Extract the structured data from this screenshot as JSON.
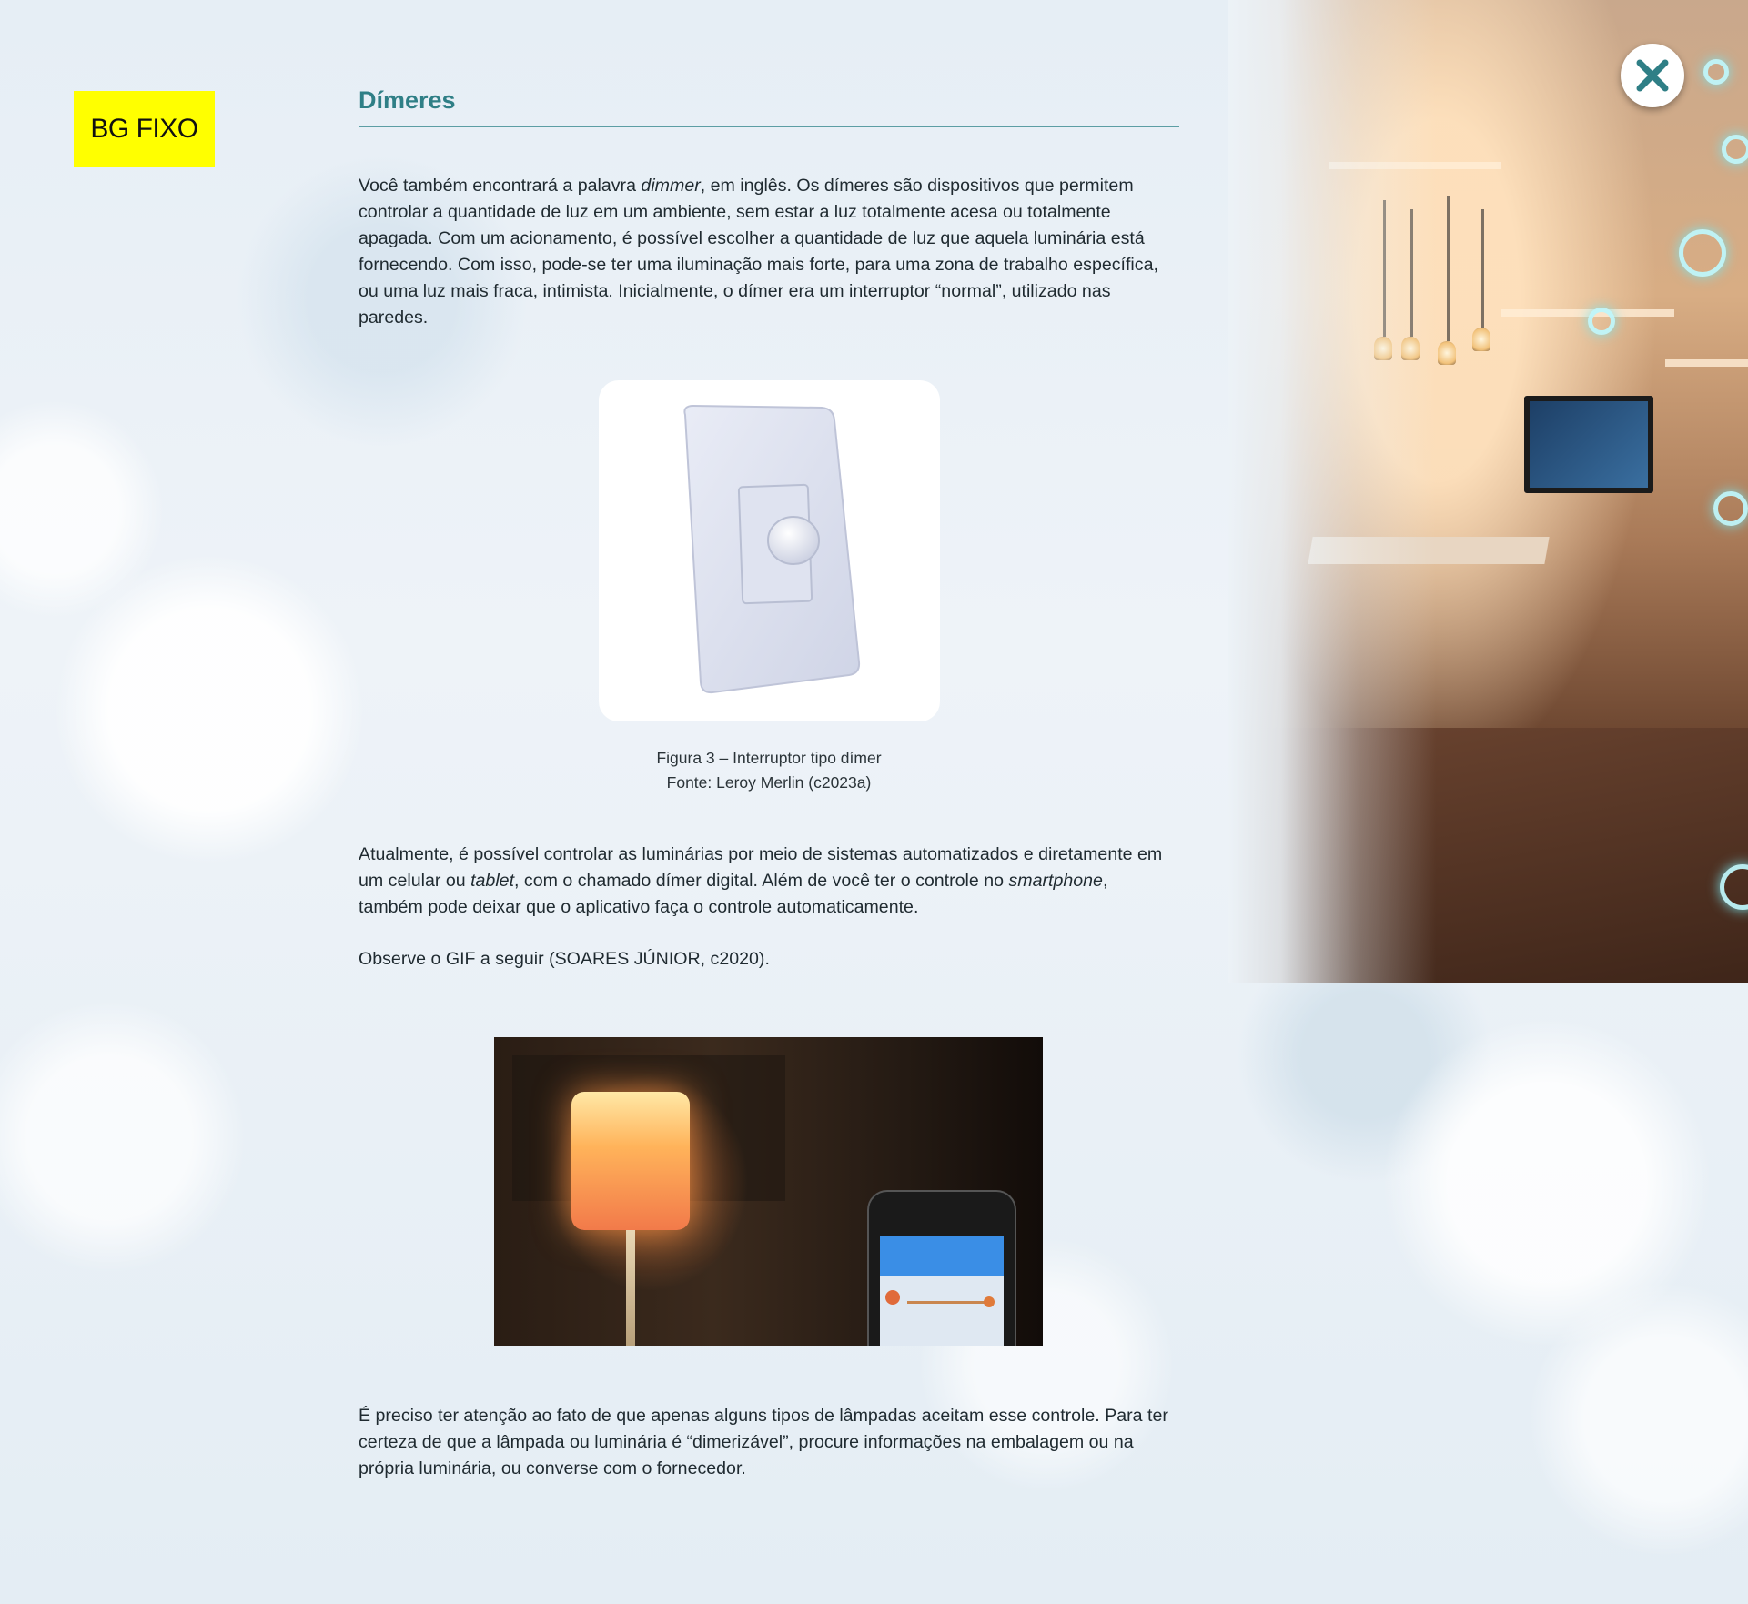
{
  "badge": {
    "label": "BG FIXO"
  },
  "close_button": {
    "icon": "close-icon",
    "color": "#2f7f86"
  },
  "section": {
    "title": "Dímeres"
  },
  "paragraph1": {
    "t1": "Você também encontrará a palavra ",
    "em1": "dimmer",
    "t2": ", em inglês. Os dímeres são dispositivos que permitem controlar a quantidade de luz em um ambiente, sem estar a luz totalmente acesa ou totalmente apagada. Com um acionamento, é possível escolher a quantidade de luz que aquela luminária está fornecendo. Com isso, pode-se ter uma iluminação mais forte, para uma zona de trabalho específica, ou uma luz mais fraca, intimista. Inicialmente, o dímer era um interruptor “normal”, utilizado nas paredes."
  },
  "figure": {
    "caption": "Figura 3 – Interruptor tipo dímer",
    "source": "Fonte: Leroy Merlin (c2023a)"
  },
  "paragraph2": {
    "t1": "Atualmente, é possível controlar as luminárias por meio de sistemas automatizados e diretamente em um celular ou ",
    "em1": "tablet",
    "t2": ", com o chamado dímer digital. Além de você ter o controle no ",
    "em2": "smartphone",
    "t3": ", também pode deixar que o aplicativo faça o controle automaticamente."
  },
  "paragraph3": {
    "text": "Observe o GIF a seguir (SOARES JÚNIOR, c2020)."
  },
  "paragraph4": {
    "text": "É preciso ter atenção ao fato de que apenas alguns tipos de lâmpadas aceitam esse controle. Para ter certeza de que a lâmpada ou luminária é “dimerizável”, procure informações na embalagem ou na própria luminária, ou converse com o fornecedor."
  },
  "colors": {
    "accent": "#2f7f86",
    "badge_bg": "#ffff00"
  }
}
